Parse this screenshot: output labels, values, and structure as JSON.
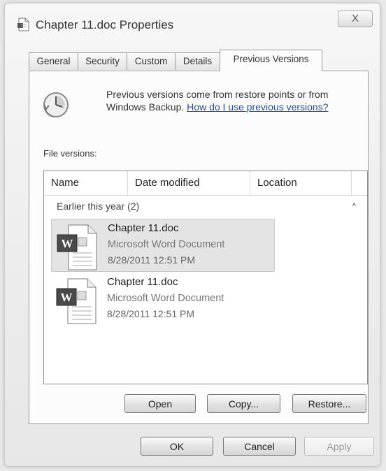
{
  "window": {
    "title": "Chapter 11.doc Properties",
    "close_label": "X"
  },
  "tabs": [
    {
      "label": "General"
    },
    {
      "label": "Security"
    },
    {
      "label": "Custom"
    },
    {
      "label": "Details"
    },
    {
      "label": "Previous Versions",
      "active": true
    }
  ],
  "info": {
    "text": "Previous versions come from restore points or from Windows Backup.",
    "link": "How do I use previous versions?"
  },
  "file_versions_label": "File versions:",
  "columns": [
    "Name",
    "Date modified",
    "Location"
  ],
  "group": {
    "label": "Earlier this year (2)",
    "collapse_glyph": "^"
  },
  "items": [
    {
      "name": "Chapter 11.doc",
      "type": "Microsoft Word Document",
      "date": "8/28/2011 12:51 PM",
      "selected": true
    },
    {
      "name": "Chapter 11.doc",
      "type": "Microsoft Word Document",
      "date": "8/28/2011 12:51 PM",
      "selected": false
    }
  ],
  "actions": {
    "open": "Open",
    "copy": "Copy...",
    "restore": "Restore..."
  },
  "dialog": {
    "ok": "OK",
    "cancel": "Cancel",
    "apply": "Apply"
  },
  "colors": {
    "link": "#1f4e9e",
    "selection": "#e4e4e4"
  }
}
